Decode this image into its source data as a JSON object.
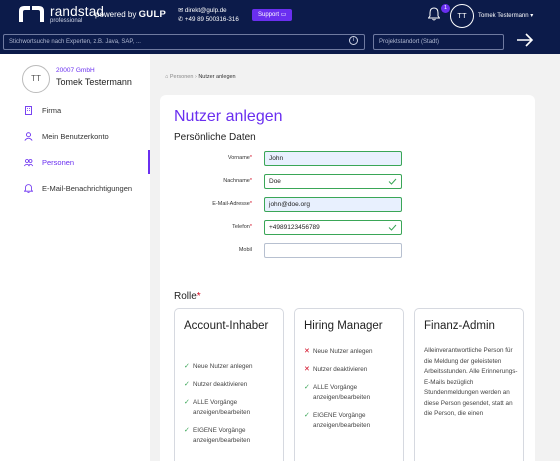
{
  "header": {
    "logo_name": "randstad",
    "logo_sub": "professional",
    "powered_prefix": "powered by",
    "powered_brand": "GULP",
    "email": "direkt@gulp.de",
    "phone": "+49 89 500316-316",
    "support_label": "Support",
    "notification_count": "1",
    "avatar_initials": "TT",
    "user_name": "Tomek Testermann"
  },
  "search": {
    "placeholder": "Stichwortsuche nach Experten, z.B. Java, SAP, ...",
    "location_placeholder": "Projektstandort (Stadt)"
  },
  "sidebar": {
    "avatar_initials": "TT",
    "company": "20007 GmbH",
    "name": "Tomek Testermann",
    "items": [
      {
        "label": "Firma"
      },
      {
        "label": "Mein Benutzerkonto"
      },
      {
        "label": "Personen"
      },
      {
        "label": "E-Mail-Benachrichtigungen"
      }
    ]
  },
  "breadcrumb": {
    "parent": "Personen",
    "current": "Nutzer anlegen"
  },
  "form": {
    "title": "Nutzer anlegen",
    "section": "Persönliche Daten",
    "fields": [
      {
        "label": "Vorname",
        "value": "John",
        "required": "*"
      },
      {
        "label": "Nachname",
        "value": "Doe",
        "required": "*"
      },
      {
        "label": "E-Mail-Adresse",
        "value": "john@doe.org",
        "required": "*"
      },
      {
        "label": "Telefon",
        "value": "+4989123456789",
        "required": "*"
      },
      {
        "label": "Mobil",
        "value": "",
        "required": ""
      }
    ],
    "role_label": "Rolle",
    "role_required": "*"
  },
  "roles": [
    {
      "title": "Account-Inhaber",
      "items": [
        {
          "text": "Neue Nutzer anlegen",
          "allowed": "yes"
        },
        {
          "text": "Nutzer deaktivieren",
          "allowed": "yes"
        },
        {
          "text": "ALLE Vorgänge anzeigen/bearbeiten",
          "allowed": "yes"
        },
        {
          "text": "EIGENE Vorgänge anzeigen/bearbeiten",
          "allowed": "yes"
        }
      ]
    },
    {
      "title": "Hiring Manager",
      "items": [
        {
          "text": "Neue Nutzer anlegen",
          "allowed": "no"
        },
        {
          "text": "Nutzer deaktivieren",
          "allowed": "no"
        },
        {
          "text": "ALLE Vorgänge anzeigen/bearbeiten",
          "allowed": "yes"
        },
        {
          "text": "EIGENE Vorgänge anzeigen/bearbeiten",
          "allowed": "yes"
        }
      ]
    },
    {
      "title": "Finanz-Admin",
      "description": "Alleinverantwortliche Person für die Meldung der geleisteten Arbeitsstunden. Alle Erinnerungs-E-Mails bezüglich Stundenmeldungen werden an diese Person gesendet, statt an die Person, die einen"
    }
  ],
  "colors": {
    "navy": "#0c1b4a",
    "accent": "#6a2ff0",
    "success": "#3aa657",
    "error": "#d0021b"
  }
}
